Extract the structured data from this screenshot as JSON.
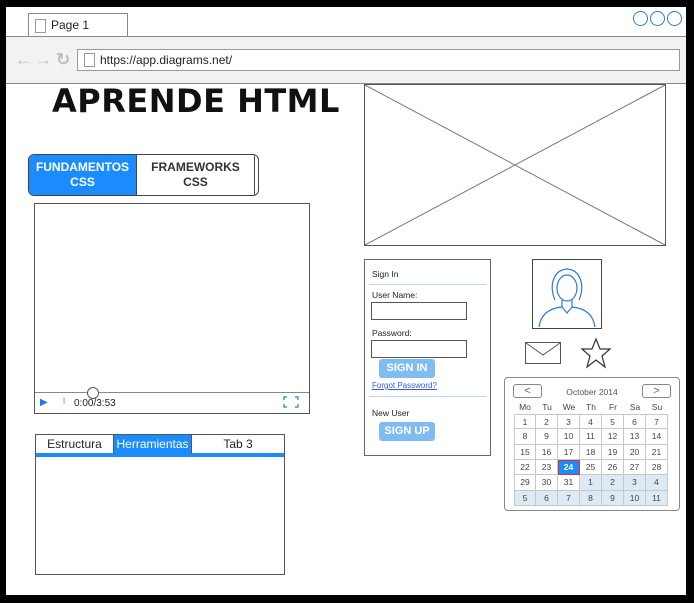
{
  "browser": {
    "tab_title": "Page 1",
    "url": "https://app.diagrams.net/"
  },
  "page": {
    "title": "APRENDE HTML"
  },
  "segmented": {
    "active_line1": "FUNDAMENTOS",
    "active_line2": "CSS",
    "inactive_line1": "FRAMEWORKS",
    "inactive_line2": "CSS"
  },
  "video": {
    "time": "0:00/3:53",
    "progress": 0.0
  },
  "tabs": [
    "Estructura",
    "Herramientas",
    "Tab 3"
  ],
  "login": {
    "heading": "Sign In",
    "username_label": "User Name:",
    "password_label": "Password:",
    "signin_button": "SIGN IN",
    "forgot_link": "Forgot Password?",
    "new_user_label": "New User",
    "signup_button": "SIGN UP"
  },
  "calendar": {
    "month": "October 2014",
    "prev": "<",
    "next": ">",
    "days_of_week": [
      "Mo",
      "Tu",
      "We",
      "Th",
      "Fr",
      "Sa",
      "Su"
    ],
    "weeks": [
      [
        "1",
        "2",
        "3",
        "4",
        "5",
        "6",
        "7"
      ],
      [
        "8",
        "9",
        "10",
        "11",
        "12",
        "13",
        "14"
      ],
      [
        "15",
        "16",
        "17",
        "18",
        "19",
        "20",
        "21"
      ],
      [
        "22",
        "23",
        "24",
        "25",
        "26",
        "27",
        "28"
      ],
      [
        "29",
        "30",
        "31",
        "1",
        "2",
        "3",
        "4"
      ],
      [
        "5",
        "6",
        "7",
        "8",
        "9",
        "10",
        "11"
      ]
    ],
    "selected_day": "24"
  },
  "colors": {
    "accent": "#1a8cff",
    "button_light": "#7fbcf2",
    "link": "#3a5ad8"
  },
  "icons": [
    "page-icon",
    "back-arrow-icon",
    "forward-arrow-icon",
    "reload-icon",
    "play-icon",
    "volume-icon",
    "fullscreen-icon",
    "mail-icon",
    "star-icon",
    "avatar-icon"
  ]
}
